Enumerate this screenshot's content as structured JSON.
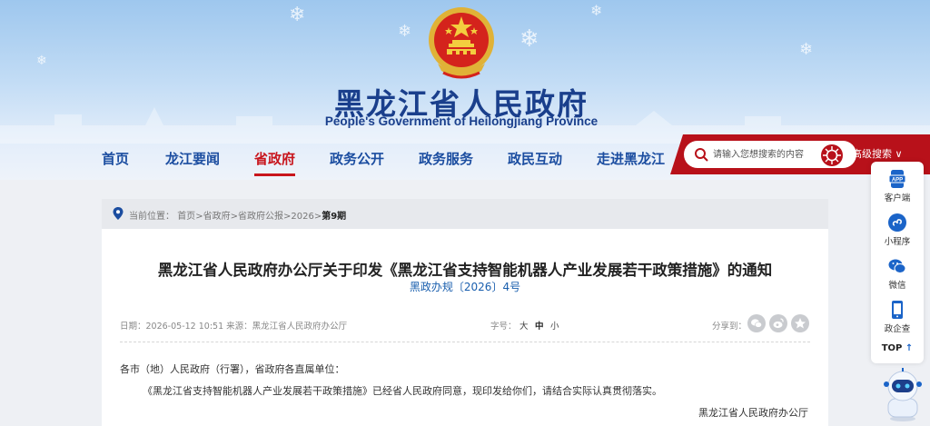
{
  "header": {
    "site_title": "黑龙江省人民政府",
    "site_subtitle": "People's Government of Heilongjiang Province"
  },
  "nav": {
    "items": [
      {
        "label": "首页"
      },
      {
        "label": "龙江要闻"
      },
      {
        "label": "省政府"
      },
      {
        "label": "政务公开"
      },
      {
        "label": "政务服务"
      },
      {
        "label": "政民互动"
      },
      {
        "label": "走进黑龙江"
      }
    ],
    "active_index": 2
  },
  "search": {
    "placeholder": "请输入您想搜索的内容",
    "advanced_label": "高级搜索 ∨"
  },
  "breadcrumb": {
    "prefix": "当前位置：",
    "items": [
      "首页",
      "省政府",
      "省政府公报",
      "2026"
    ],
    "current": "第9期",
    "separator": ">"
  },
  "article": {
    "title": "黑龙江省人民政府办公厅关于印发《黑龙江省支持智能机器人产业发展若干政策措施》的通知",
    "doc_number": "黑政办规〔2026〕4号",
    "meta": "日期：2026-05-12 10:51 来源：黑龙江省人民政府办公厅",
    "font_size_label": "字号：",
    "font_sizes": [
      "大",
      "中",
      "小"
    ],
    "share_label": "分享到：",
    "salutation": "各市（地）人民政府（行署），省政府各直属单位：",
    "body": "《黑龙江省支持智能机器人产业发展若干政策措施》已经省人民政府同意，现印发给你们，请结合实际认真贯彻落实。",
    "signature": "黑龙江省人民政府办公厅"
  },
  "float_bar": {
    "items": [
      {
        "label": "客户端",
        "icon": "app-icon"
      },
      {
        "label": "小程序",
        "icon": "mini-program-icon"
      },
      {
        "label": "微信",
        "icon": "wechat-icon"
      },
      {
        "label": "政企查",
        "icon": "phone-icon"
      }
    ],
    "top_label": "TOP",
    "top_arrow": "↑"
  },
  "colors": {
    "nav_text": "#1b4da0",
    "accent_red": "#c8161d",
    "title_blue": "#1a3f8c"
  }
}
